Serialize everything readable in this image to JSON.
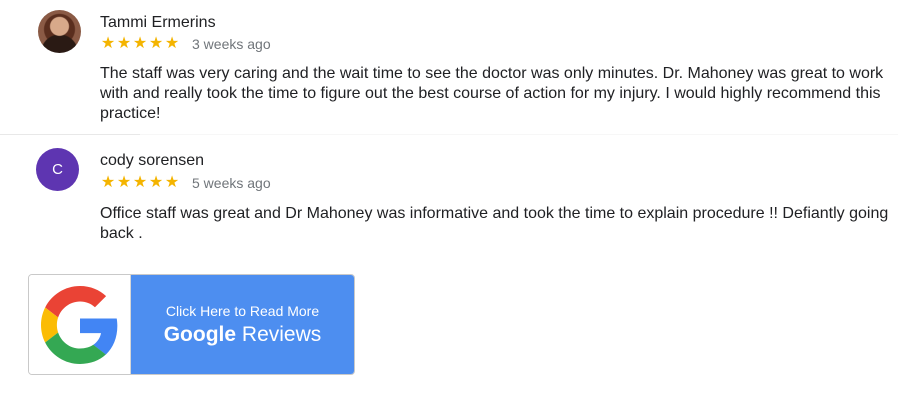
{
  "reviews": [
    {
      "author": "Tammi Ermerins",
      "rating": 5,
      "stars": "★★★★★",
      "time": "3 weeks ago",
      "text": "The staff was very caring and the wait time to see the doctor was only minutes. Dr. Mahoney was great to work with and really took the time to figure out the best course of action for my injury. I would highly recommend this practice!"
    },
    {
      "author": "cody sorensen",
      "avatar_letter": "C",
      "avatar_color": "#5e35b1",
      "rating": 5,
      "stars": "★★★★★",
      "time": "5 weeks ago",
      "text": "Office staff was great and Dr Mahoney was informative and took the time to explain procedure !! Defiantly going back ."
    }
  ],
  "google_button": {
    "line1": "Click Here to Read More",
    "brand": "Google",
    "suffix": "Reviews",
    "icon": "google-g-logo",
    "color": "#4d8ef0"
  },
  "colors": {
    "star": "#f4b400",
    "text": "#202124",
    "muted": "#70757a"
  }
}
